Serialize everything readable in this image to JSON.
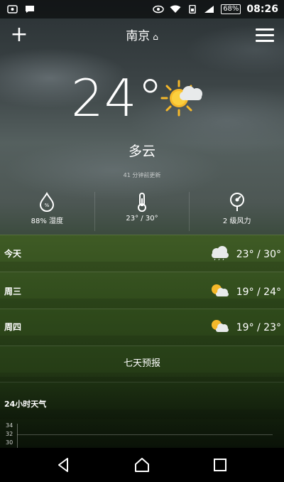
{
  "status_bar": {
    "battery": "68%",
    "time": "08:26",
    "icons": [
      "notification-icon",
      "message-icon",
      "eye-icon",
      "wifi-icon",
      "sim-icon",
      "signal-icon",
      "battery-icon"
    ]
  },
  "header": {
    "city": "南京",
    "home_icon": "⌂",
    "add_icon": "+"
  },
  "current": {
    "temperature": "24°",
    "condition": "多云",
    "updated": "41 分钟前更新",
    "icon": "partly-cloudy-icon"
  },
  "metrics": [
    {
      "icon": "humidity-icon",
      "value": "88% 湿度"
    },
    {
      "icon": "thermometer-icon",
      "value": "23° / 30°"
    },
    {
      "icon": "wind-icon",
      "value": "2 级风力"
    }
  ],
  "forecast": [
    {
      "day": "今天",
      "icon": "cloudy-icon",
      "range": "23° / 30°"
    },
    {
      "day": "周三",
      "icon": "partly-cloudy-icon",
      "range": "19° / 24°"
    },
    {
      "day": "周四",
      "icon": "partly-cloudy-icon",
      "range": "19° / 23°"
    }
  ],
  "seven_day_label": "七天预报",
  "hourly": {
    "title": "24小时天气",
    "y_labels": [
      "34",
      "32",
      "30"
    ]
  },
  "colors": {
    "sun": "#f5b82a",
    "cloud": "#e8eaeb"
  }
}
